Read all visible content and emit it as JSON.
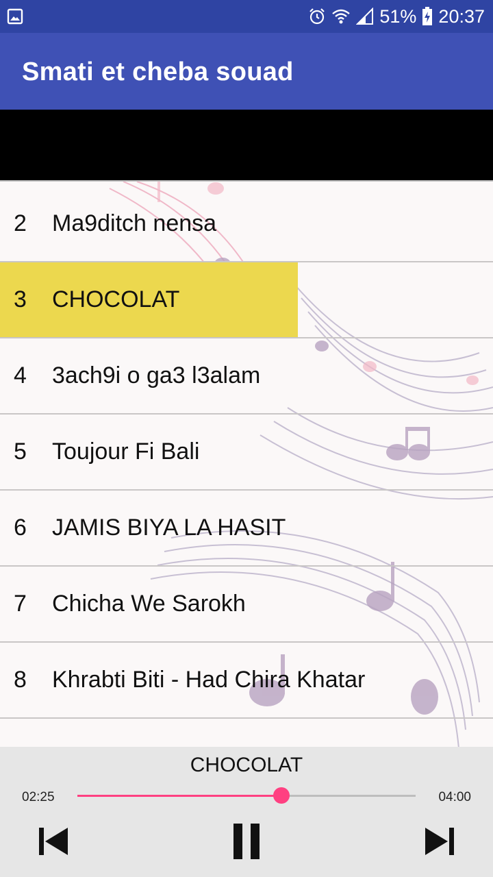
{
  "status_bar": {
    "battery": "51%",
    "time": "20:37",
    "icons": [
      "gallery-icon",
      "alarm-icon",
      "wifi-icon",
      "signal-icon",
      "battery-icon"
    ]
  },
  "app_bar": {
    "title": "Smati et cheba souad"
  },
  "tracks": [
    {
      "number": "2",
      "title": "Ma9ditch nensa",
      "highlighted": false
    },
    {
      "number": "3",
      "title": "CHOCOLAT",
      "highlighted": true
    },
    {
      "number": "4",
      "title": "3ach9i o ga3 l3alam",
      "highlighted": false
    },
    {
      "number": "5",
      "title": "Toujour Fi Bali",
      "highlighted": false
    },
    {
      "number": "6",
      "title": "JAMIS BIYA LA HASIT",
      "highlighted": false
    },
    {
      "number": "7",
      "title": "Chicha We Sarokh",
      "highlighted": false
    },
    {
      "number": "8",
      "title": "Khrabti Biti - Had Chira Khatar",
      "highlighted": false
    }
  ],
  "player": {
    "now_playing": "CHOCOLAT",
    "elapsed": "02:25",
    "total": "04:00",
    "progress": 0.604,
    "controls": [
      "skip-previous-icon",
      "pause-icon",
      "skip-next-icon"
    ]
  },
  "colors": {
    "status_bar": "#2f44a3",
    "app_bar": "#3f51b5",
    "highlight": "#ecd84e",
    "accent": "#ff4081"
  }
}
